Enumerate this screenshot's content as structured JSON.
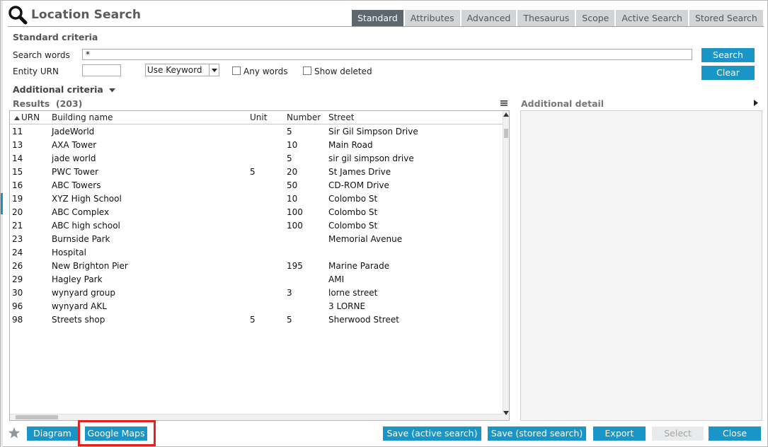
{
  "window": {
    "title": "Location Search"
  },
  "tabs": [
    {
      "label": "Standard",
      "active": true
    },
    {
      "label": "Attributes"
    },
    {
      "label": "Advanced"
    },
    {
      "label": "Thesaurus"
    },
    {
      "label": "Scope"
    },
    {
      "label": "Active Search"
    },
    {
      "label": "Stored Search"
    }
  ],
  "standard_criteria": {
    "title": "Standard criteria",
    "search_words_label": "Search words",
    "search_words_value": "*",
    "entity_urn_label": "Entity URN",
    "entity_urn_value": "",
    "keyword_select_value": "Use Keyword",
    "any_words_label": "Any words",
    "show_deleted_label": "Show deleted",
    "search_button": "Search",
    "clear_button": "Clear"
  },
  "additional_criteria": {
    "label": "Additional criteria"
  },
  "results": {
    "label": "Results",
    "count": "(203)",
    "columns": [
      "URN",
      "Building name",
      "Unit",
      "Number",
      "Street"
    ],
    "rows": [
      {
        "urn": "11",
        "building": "JadeWorld",
        "unit": "",
        "number": "5",
        "street": "Sir Gil Simpson Drive"
      },
      {
        "urn": "13",
        "building": "AXA Tower",
        "unit": "",
        "number": "10",
        "street": "Main Road"
      },
      {
        "urn": "14",
        "building": "jade world",
        "unit": "",
        "number": "5",
        "street": "sir gil simpson drive"
      },
      {
        "urn": "15",
        "building": "PWC Tower",
        "unit": "5",
        "number": "20",
        "street": "St James Drive"
      },
      {
        "urn": "16",
        "building": "ABC Towers",
        "unit": "",
        "number": "50",
        "street": "CD-ROM Drive"
      },
      {
        "urn": "19",
        "building": "XYZ High School",
        "unit": "",
        "number": "10",
        "street": "Colombo St"
      },
      {
        "urn": "20",
        "building": "ABC Complex",
        "unit": "",
        "number": "100",
        "street": "Colombo St"
      },
      {
        "urn": "21",
        "building": "ABC high school",
        "unit": "",
        "number": "100",
        "street": "Colombo St"
      },
      {
        "urn": "23",
        "building": "Burnside Park",
        "unit": "",
        "number": "",
        "street": "Memorial Avenue"
      },
      {
        "urn": "24",
        "building": "Hospital",
        "unit": "",
        "number": "",
        "street": ""
      },
      {
        "urn": "26",
        "building": "New Brighton Pier",
        "unit": "",
        "number": "195",
        "street": "Marine Parade"
      },
      {
        "urn": "29",
        "building": "Hagley Park",
        "unit": "",
        "number": "",
        "street": "AMI"
      },
      {
        "urn": "30",
        "building": "wynyard group",
        "unit": "",
        "number": "3",
        "street": "lorne street"
      },
      {
        "urn": "96",
        "building": "wynyard AKL",
        "unit": "",
        "number": "",
        "street": "3 LORNE"
      },
      {
        "urn": "98",
        "building": "Streets shop",
        "unit": "5",
        "number": "5",
        "street": "Sherwood Street"
      }
    ]
  },
  "detail": {
    "label": "Additional detail"
  },
  "footer": {
    "diagram": "Diagram",
    "google_maps": "Google Maps",
    "save_active": "Save (active search)",
    "save_stored": "Save (stored search)",
    "export": "Export",
    "select": "Select",
    "close": "Close"
  },
  "colors": {
    "accent": "#1a95c7",
    "tab_active": "#5d6770",
    "tab_inactive": "#d2d5d8",
    "highlight": "#e3211f"
  },
  "icons": [
    "search-icon",
    "sort-asc-icon",
    "chevron-down-icon",
    "menu-icon",
    "chevron-right-icon",
    "star-icon"
  ]
}
